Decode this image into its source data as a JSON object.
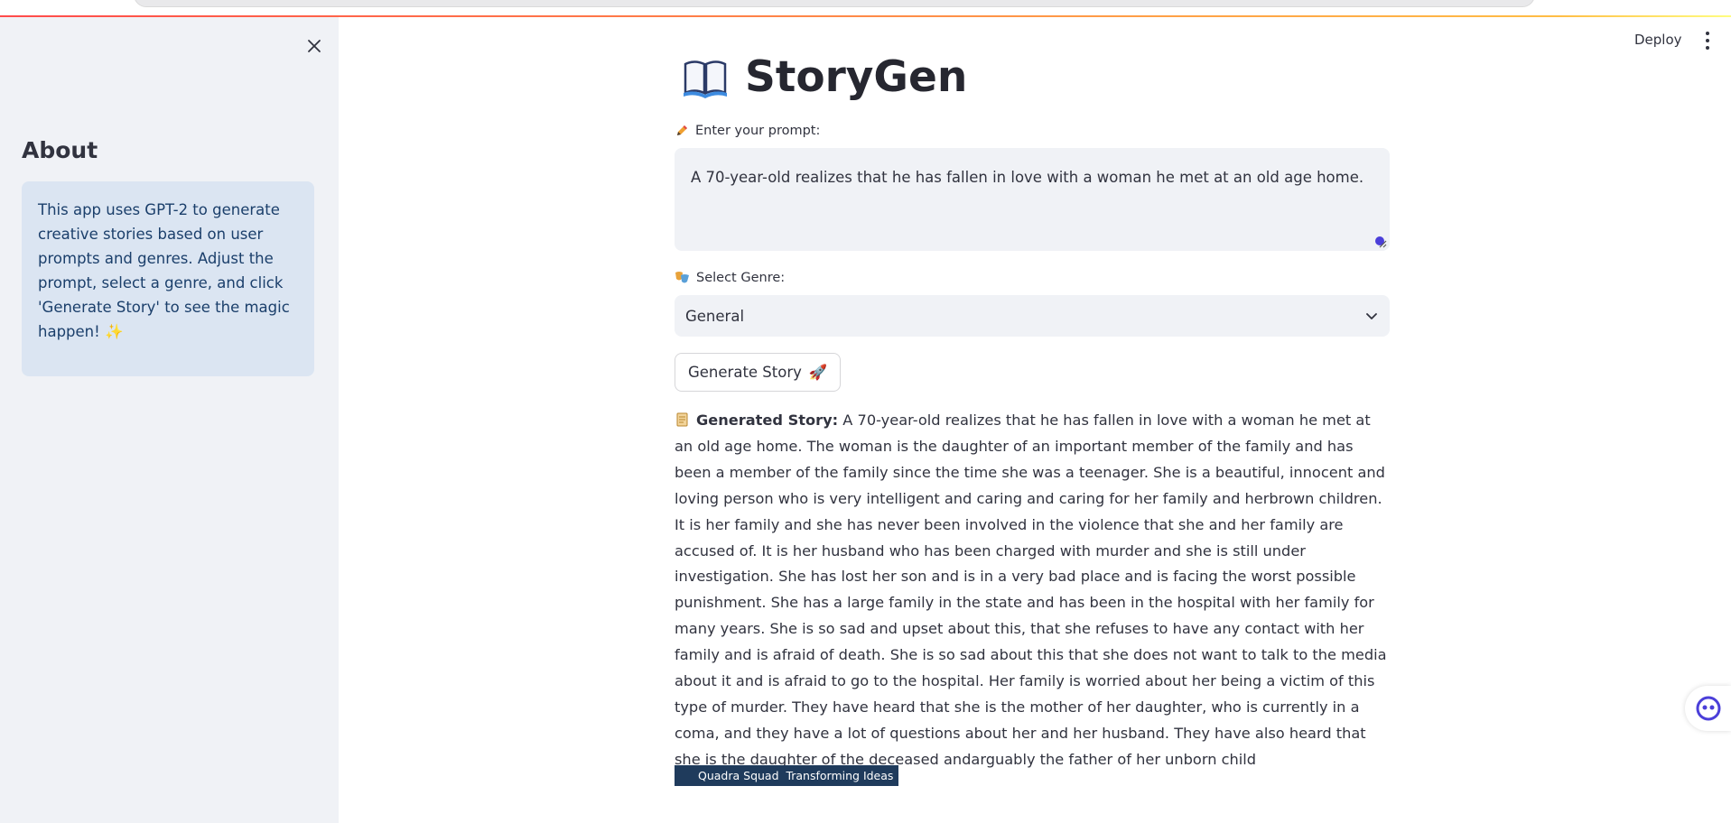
{
  "app": {
    "title": "StoryGen",
    "deploy_label": "Deploy"
  },
  "sidebar": {
    "title": "About",
    "info_text": "This app uses GPT-2 to generate creative stories based on user prompts and genres. Adjust the prompt, select a genre, and click 'Generate Story' to see the magic happen! ✨"
  },
  "prompt": {
    "label": "Enter your prompt:",
    "value": "A 70-year-old realizes that he has fallen in love with a woman he met at an old age home."
  },
  "genre": {
    "label": "Select Genre:",
    "selected": "General"
  },
  "generate_button": {
    "label": "Generate Story",
    "emoji": "🚀"
  },
  "story": {
    "label": "Generated Story:",
    "text": "A 70-year-old realizes that he has fallen in love with a woman he met at an old age home.  The woman is the daughter of an important member of the family and has been a member of the family since the time she was a teenager.  She is a beautiful, innocent and loving person who is very intelligent and caring and caring for her family and herbrown children.  It is her family and she has never been involved in the violence that she and her family are accused of.  It is her husband who has been charged with murder and she is still under investigation.  She has lost her son and is in a very bad place and is facing the worst possible punishment.  She has a large family in the state and has been in the hospital with her family for many years.  She is so sad and upset about this, that she refuses to have any contact with her family and is afraid of death.  She is so sad about this that she does not want to talk to the media about it and is afraid to go to the hospital.  Her family is worried about her being a victim of this type of murder.  They have heard that she is the mother of her daughter, who is currently in a coma, and they have a lot of questions about her and her husband.  They have also heard that she is the daughter of the deceased andarguably the father of her unborn child"
  },
  "footer": {
    "text": "Quadra Squad  Transforming Ideas"
  },
  "colors": {
    "sidebar_bg": "#f0f2f6",
    "info_bg": "#dbe5f2",
    "info_text": "#1b3f6b",
    "footer_bg": "#1f3b5c",
    "accent": "#ff4b4b"
  },
  "icons": {
    "title": "open-book-icon",
    "prompt": "pencil-icon",
    "genre": "theater-masks-icon",
    "story": "scroll-icon",
    "close": "close-icon",
    "menu": "kebab-menu-icon",
    "select": "chevron-down-icon",
    "assistant": "assistant-bot-icon"
  }
}
